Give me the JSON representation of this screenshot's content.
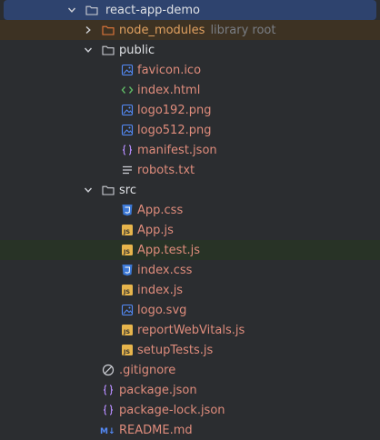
{
  "colors": {
    "background": "#2b2d30",
    "selected_row": "#2e436e",
    "excluded_row": "#3d3223",
    "modified_row": "#283326",
    "changed_file_text": "#df8c7c",
    "folder_text": "#dfe1e5",
    "hint_text": "#7a7e85"
  },
  "tree": {
    "root": {
      "label": "react-app-demo",
      "icon": "folder-icon",
      "state": "expanded"
    },
    "node_modules": {
      "label": "node_modules",
      "hint": "library root",
      "icon": "folder-icon",
      "state": "collapsed"
    },
    "public": {
      "label": "public",
      "icon": "folder-icon",
      "state": "expanded",
      "files": [
        {
          "label": "favicon.ico",
          "icon": "image-file-icon"
        },
        {
          "label": "index.html",
          "icon": "html-file-icon"
        },
        {
          "label": "logo192.png",
          "icon": "image-file-icon"
        },
        {
          "label": "logo512.png",
          "icon": "image-file-icon"
        },
        {
          "label": "manifest.json",
          "icon": "json-file-icon"
        },
        {
          "label": "robots.txt",
          "icon": "text-file-icon"
        }
      ]
    },
    "src": {
      "label": "src",
      "icon": "folder-icon",
      "state": "expanded",
      "files": [
        {
          "label": "App.css",
          "icon": "css-file-icon"
        },
        {
          "label": "App.js",
          "icon": "js-file-icon"
        },
        {
          "label": "App.test.js",
          "icon": "js-file-icon"
        },
        {
          "label": "index.css",
          "icon": "css-file-icon"
        },
        {
          "label": "index.js",
          "icon": "js-file-icon"
        },
        {
          "label": "logo.svg",
          "icon": "image-file-icon"
        },
        {
          "label": "reportWebVitals.js",
          "icon": "js-file-icon"
        },
        {
          "label": "setupTests.js",
          "icon": "js-file-icon"
        }
      ]
    },
    "root_files": [
      {
        "label": ".gitignore",
        "icon": "ignore-file-icon"
      },
      {
        "label": "package.json",
        "icon": "json-file-icon"
      },
      {
        "label": "package-lock.json",
        "icon": "json-file-icon"
      },
      {
        "label": "README.md",
        "icon": "markdown-file-icon"
      }
    ]
  }
}
